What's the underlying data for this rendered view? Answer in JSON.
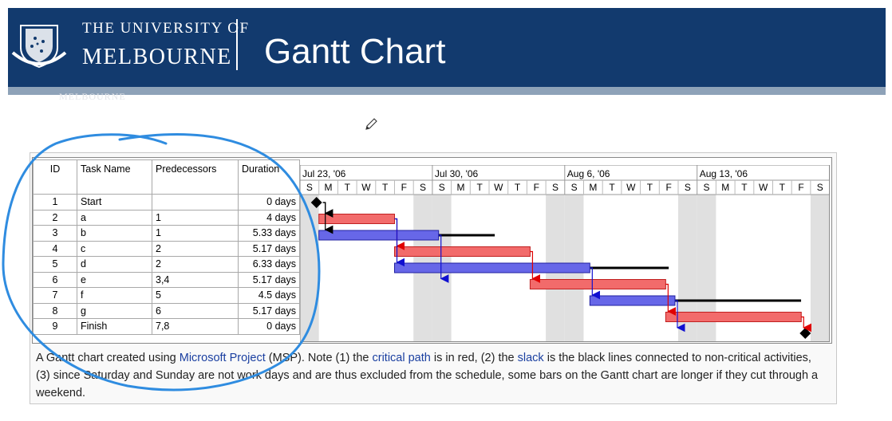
{
  "header": {
    "university_line1": "THE UNIVERSITY OF",
    "university_line2": "MELBOURNE",
    "title": "Gantt Chart",
    "ghost_text": "MELBOURNE"
  },
  "table": {
    "columns": [
      "ID",
      "Task Name",
      "Predecessors",
      "Duration"
    ],
    "rows": [
      {
        "id": "1",
        "name": "Start",
        "pred": "",
        "dur": "0 days"
      },
      {
        "id": "2",
        "name": "a",
        "pred": "1",
        "dur": "4 days"
      },
      {
        "id": "3",
        "name": "b",
        "pred": "1",
        "dur": "5.33 days"
      },
      {
        "id": "4",
        "name": "c",
        "pred": "2",
        "dur": "5.17 days"
      },
      {
        "id": "5",
        "name": "d",
        "pred": "2",
        "dur": "6.33 days"
      },
      {
        "id": "6",
        "name": "e",
        "pred": "3,4",
        "dur": "5.17 days"
      },
      {
        "id": "7",
        "name": "f",
        "pred": "5",
        "dur": "4.5 days"
      },
      {
        "id": "8",
        "name": "g",
        "pred": "6",
        "dur": "5.17 days"
      },
      {
        "id": "9",
        "name": "Finish",
        "pred": "7,8",
        "dur": "0 days"
      }
    ]
  },
  "timeline": {
    "weeks": [
      "Jul 23, '06",
      "Jul 30, '06",
      "Aug 6, '06",
      "Aug 13, '06"
    ],
    "days": [
      "S",
      "M",
      "T",
      "W",
      "T",
      "F",
      "S"
    ]
  },
  "chart_data": {
    "type": "gantt",
    "unit": "days",
    "tasks": [
      {
        "id": "1",
        "type": "milestone",
        "start": 1
      },
      {
        "id": "2",
        "type": "task",
        "critical": true,
        "start": 1,
        "end": 5
      },
      {
        "id": "3",
        "type": "task",
        "critical": false,
        "start": 1,
        "end": 7.33,
        "slack_end": 10.3
      },
      {
        "id": "4",
        "type": "task",
        "critical": true,
        "start": 5,
        "end": 12.17
      },
      {
        "id": "5",
        "type": "task",
        "critical": false,
        "start": 5,
        "end": 15.33,
        "slack_end": 19.5
      },
      {
        "id": "6",
        "type": "task",
        "critical": true,
        "start": 12.17,
        "end": 19.34
      },
      {
        "id": "7",
        "type": "task",
        "critical": false,
        "start": 15.33,
        "end": 19.83,
        "slack_end": 26.5
      },
      {
        "id": "8",
        "type": "task",
        "critical": true,
        "start": 19.34,
        "end": 26.51
      },
      {
        "id": "9",
        "type": "milestone",
        "start": 26.51
      }
    ],
    "links": [
      [
        "1",
        "2"
      ],
      [
        "1",
        "3"
      ],
      [
        "2",
        "4"
      ],
      [
        "2",
        "5"
      ],
      [
        "3",
        "6"
      ],
      [
        "4",
        "6"
      ],
      [
        "5",
        "7"
      ],
      [
        "6",
        "8"
      ],
      [
        "7",
        "9"
      ],
      [
        "8",
        "9"
      ]
    ],
    "colors": {
      "critical_fill": "#f26b6b",
      "critical_border": "#c02020",
      "normal_fill": "#6767e8",
      "normal_border": "#2020a0",
      "slack": "#000000",
      "weekend": "#e0e0e0"
    }
  },
  "caption": {
    "p1": "A Gantt chart created using ",
    "link1": "Microsoft Project",
    "p2": " (MSP). Note (1) the ",
    "link2": "critical path",
    "p3": " is in red, (2) the ",
    "link3": "slack",
    "p4": " is the black lines connected to non-critical activities, (3) since Saturday and Sunday are not work days and are thus excluded from the schedule, some bars on the Gantt chart are longer if they cut through a weekend."
  },
  "annotation": {
    "color": "#2f8ce0"
  }
}
